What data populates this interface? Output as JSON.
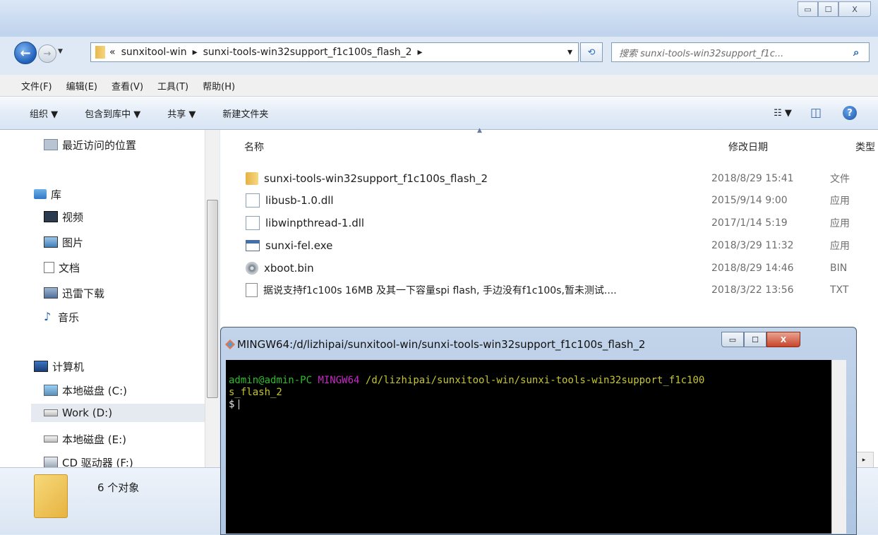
{
  "window_controls": {
    "minimize": "▭",
    "maximize": "☐",
    "close": "X"
  },
  "nav": {
    "back_glyph": "←",
    "forward_glyph": "→",
    "dropdown_glyph": "▼",
    "address_parts": [
      "«",
      "sunxitool-win",
      "▸",
      "sunxi-tools-win32support_f1c100s_flash_2",
      "▸"
    ],
    "address_dropdown": "▾",
    "refresh_glyph": "⟲",
    "search_placeholder": "搜索 sunxi-tools-win32support_f1c...",
    "search_glyph": "⌕"
  },
  "menu": [
    "文件(F)",
    "编辑(E)",
    "查看(V)",
    "工具(T)",
    "帮助(H)"
  ],
  "toolbar": {
    "organize": "组织 ▼",
    "include_library": "包含到库中 ▼",
    "share": "共享 ▼",
    "new_folder": "新建文件夹",
    "view_glyph": "☷ ▼",
    "pane_glyph": "◫",
    "help_glyph": "?"
  },
  "sidebar": {
    "recent": "最近访问的位置",
    "library": "库",
    "videos": "视频",
    "pictures": "图片",
    "documents": "文档",
    "thunder": "迅雷下载",
    "music": "音乐",
    "computer": "计算机",
    "drive_c": "本地磁盘 (C:)",
    "drive_d": "Work (D:)",
    "drive_e": "本地磁盘 (E:)",
    "drive_f": "CD 驱动器 (F:)"
  },
  "columns": {
    "name": "名称",
    "date": "修改日期",
    "type": "类型"
  },
  "sort_arrow": "▲",
  "files": [
    {
      "name": "sunxi-tools-win32support_f1c100s_flash_2",
      "date": "2018/8/29 15:41",
      "type": "文件",
      "icon": "folder-icon"
    },
    {
      "name": "libusb-1.0.dll",
      "date": "2015/9/14 9:00",
      "type": "应用",
      "icon": "dll-icon"
    },
    {
      "name": "libwinpthread-1.dll",
      "date": "2017/1/14 5:19",
      "type": "应用",
      "icon": "dll-icon"
    },
    {
      "name": "sunxi-fel.exe",
      "date": "2018/3/29 11:32",
      "type": "应用",
      "icon": "exe-icon"
    },
    {
      "name": "xboot.bin",
      "date": "2018/8/29 14:46",
      "type": "BIN",
      "icon": "disc-icon"
    },
    {
      "name": "据说支持f1c100s 16MB 及其一下容量spi flash, 手边没有f1c100s,暂未测试....",
      "date": "2018/3/22 13:56",
      "type": "TXT",
      "icon": "text-file-icon"
    }
  ],
  "status": {
    "count": "6 个对象"
  },
  "terminal": {
    "title": "MINGW64:/d/lizhipai/sunxitool-win/sunxi-tools-win32support_f1c100s_flash_2",
    "user_host": "admin@admin-PC",
    "env": "MINGW64",
    "path_line1": "/d/lizhipai/sunxitool-win/sunxi-tools-win32support_f1c100",
    "path_line2": "s_flash_2",
    "prompt": "$"
  },
  "colors": {
    "term_green": "#2bbd2b",
    "term_magenta": "#c627c6",
    "term_yellow": "#c6c62b",
    "selection": "#e5eaf1"
  }
}
